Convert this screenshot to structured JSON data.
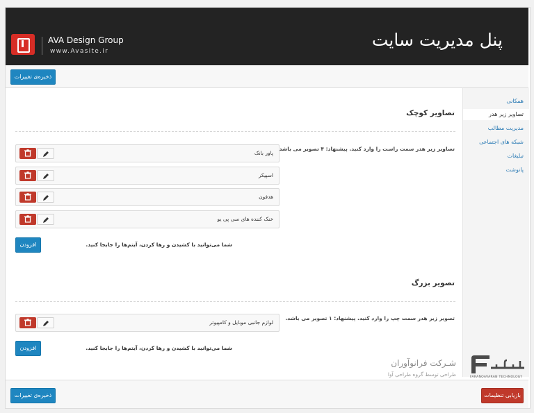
{
  "header": {
    "title": "پنل مدیریت سایت",
    "brand_name": "AVA Design Group",
    "brand_url": "www.Avasite.ir",
    "background": "#232323"
  },
  "toolbar": {
    "save_label": "ذخیره‌ی تغییرات"
  },
  "sidebar": {
    "items": [
      {
        "label": "همکانی",
        "active": false
      },
      {
        "label": "تصاویر زیر هدر",
        "active": true
      },
      {
        "label": "مدیریت مطالب",
        "active": false
      },
      {
        "label": "شبکه های اجتماعی",
        "active": false
      },
      {
        "label": "تبلیغات",
        "active": false
      },
      {
        "label": "پانوشت",
        "active": false
      }
    ]
  },
  "small_images": {
    "title": "تصاویر کوچک",
    "description": "تصاویر زیر هدر سمت راست را وارد کنید. پیشنهاد: ۴ تصویر می باشد.",
    "items": [
      "پاور بانک",
      "اسپیکر",
      "هدفون",
      "خنک کننده های سی پی یو"
    ],
    "hint": "شما می‌توانید با کشیدن و رها کردن، آیتم‌ها را جابجا کنید.",
    "add_label": "افزودن"
  },
  "large_image": {
    "title": "تصویر بزرگ",
    "description": "تصویر زیر هدر سمت چپ را وارد کنید. پیشنهاد: ۱ تصویر می باشد.",
    "items": [
      "لوازم جانبی موبایل و کامپیوتر"
    ],
    "hint": "شما می‌توانید با کشیدن و رها کردن، آیتم‌ها را جابجا کنید.",
    "add_label": "افزودن"
  },
  "watermark": {
    "company": "شـرکت فرانوآوران",
    "subtitle": "طراحی توسط گروه طراحی آوا",
    "logo_text": "FARANOAVARAN TECHNOLOGY"
  },
  "footer": {
    "reset_label": "بازیابی تنظیمات",
    "save_label": "ذخیره‌ی تغییرات"
  },
  "colors": {
    "accent_blue": "#1f86c0",
    "danger_red": "#c0392b",
    "link_blue": "#2a7ab4"
  },
  "icons": {
    "edit": "pencil-icon",
    "delete": "trash-icon"
  }
}
